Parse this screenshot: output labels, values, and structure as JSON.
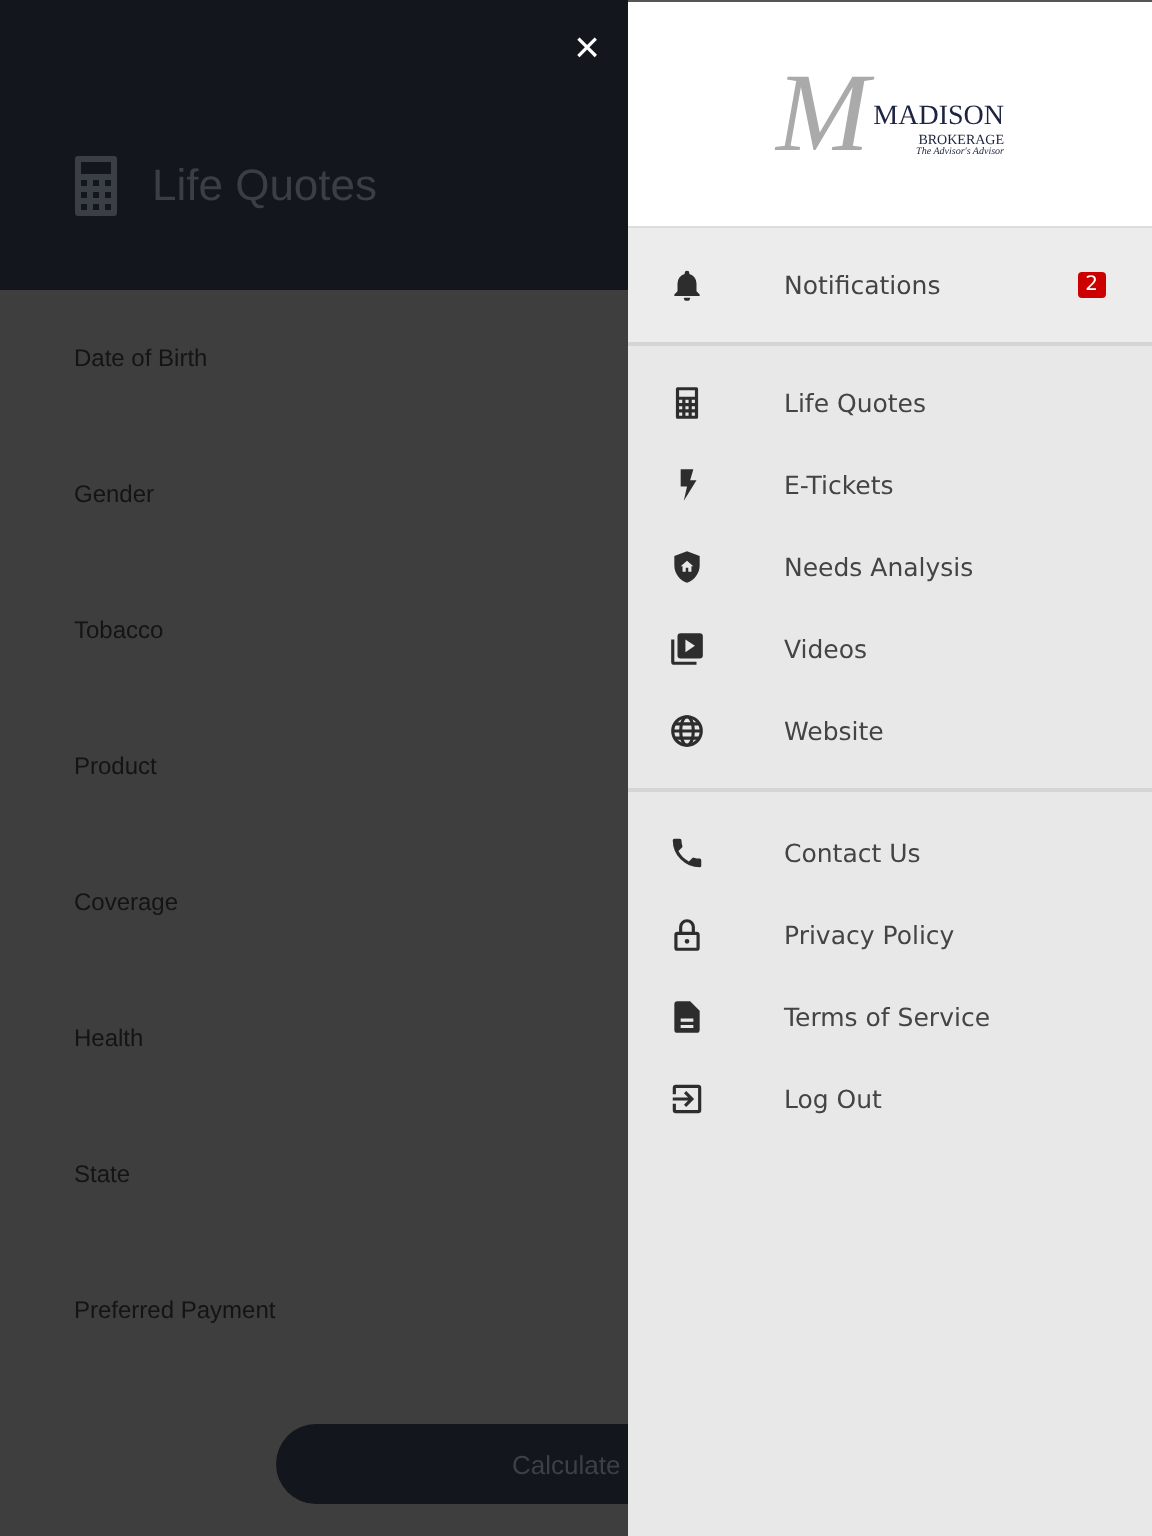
{
  "header": {
    "title": "Life Quotes",
    "close": "×"
  },
  "form": {
    "fields": [
      "Date of Birth",
      "Gender",
      "Tobacco",
      "Product",
      "Coverage",
      "Health",
      "State",
      "Preferred Payment"
    ],
    "button": "Calculate"
  },
  "drawer": {
    "logo": {
      "initial": "M",
      "name": "MADISON",
      "sub": "BROKERAGE",
      "tagline": "The Advisor's Advisor"
    },
    "sections": [
      [
        {
          "label": "Notifications",
          "badge": "2"
        }
      ],
      [
        {
          "label": "Life Quotes"
        },
        {
          "label": "E-Tickets"
        },
        {
          "label": "Needs Analysis"
        },
        {
          "label": "Videos"
        },
        {
          "label": "Website"
        }
      ],
      [
        {
          "label": "Contact Us"
        },
        {
          "label": "Privacy Policy"
        },
        {
          "label": "Terms of Service"
        },
        {
          "label": "Log Out"
        }
      ]
    ]
  }
}
